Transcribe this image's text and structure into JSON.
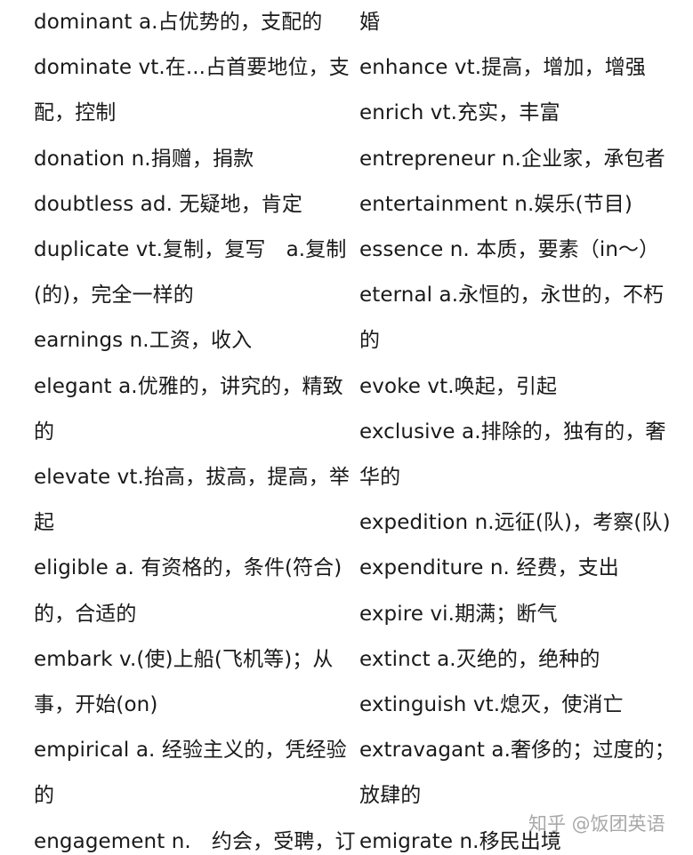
{
  "left_column": [
    "dominant a.占优势的，支配的",
    "dominate vt.在...占首要地位，支",
    "配，控制",
    "donation n.捐赠，捐款",
    "doubtless ad. 无疑地，肯定",
    "duplicate vt.复制，复写　a.复制",
    "(的)，完全一样的",
    "earnings n.工资，收入",
    "elegant a.优雅的，讲究的，精致",
    "的",
    "elevate vt.抬高，拔高，提高，举",
    "起",
    "eligible a. 有资格的，条件(符合)",
    "的，合适的",
    "embark v.(使)上船(飞机等)；从",
    "事，开始(on)",
    "empirical a. 经验主义的，凭经验",
    "的",
    "engagement n.　约会，受聘，订"
  ],
  "right_column": [
    "婚",
    "enhance vt.提高，增加，增强",
    "enrich vt.充实，丰富",
    "entrepreneur n.企业家，承包者",
    "entertainment n.娱乐(节目)",
    "essence n. 本质，要素（in～）",
    "eternal a.永恒的，永世的，不朽",
    "的",
    "evoke vt.唤起，引起",
    "exclusive a.排除的，独有的，奢",
    "华的",
    "expedition n.远征(队)，考察(队)",
    "expenditure n. 经费，支出",
    "expire vi.期满；断气",
    "extinct a.灭绝的，绝种的",
    "extinguish vt.熄灭，使消亡",
    "extravagant a.奢侈的；过度的；",
    "放肆的",
    "emigrate n.移民出境"
  ],
  "watermark": "知乎 @饭团英语"
}
